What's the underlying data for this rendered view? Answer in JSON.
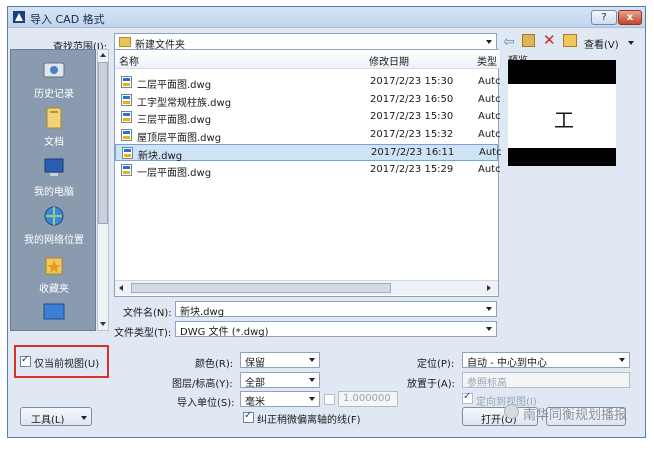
{
  "window": {
    "title": "导入 CAD 格式",
    "help_label": "?",
    "close_label": "x"
  },
  "toolbar": {
    "lookin_label": "查找范围(I):",
    "lookin_value": "新建文件夹",
    "view_label": "查看(V)"
  },
  "places": [
    {
      "label": "历史记录",
      "icon": "history-icon"
    },
    {
      "label": "文档",
      "icon": "documents-icon"
    },
    {
      "label": "我的电脑",
      "icon": "computer-icon"
    },
    {
      "label": "我的网络位置",
      "icon": "network-icon"
    },
    {
      "label": "收藏夹",
      "icon": "favorites-icon"
    }
  ],
  "columns": {
    "name": "名称",
    "modified": "修改日期",
    "type": "类型"
  },
  "files": [
    {
      "name": "二层平面图.dwg",
      "date": "2017/2/23 15:30",
      "type": "Autc"
    },
    {
      "name": "工字型常规柱族.dwg",
      "date": "2017/2/23 16:50",
      "type": "Autc"
    },
    {
      "name": "三层平面图.dwg",
      "date": "2017/2/23 15:30",
      "type": "Autc"
    },
    {
      "name": "屋顶层平面图.dwg",
      "date": "2017/2/23 15:32",
      "type": "Autc"
    },
    {
      "name": "新块.dwg",
      "date": "2017/2/23 16:11",
      "type": "Autc"
    },
    {
      "name": "一层平面图.dwg",
      "date": "2017/2/23 15:29",
      "type": "Autc"
    }
  ],
  "preview": {
    "label": "预览",
    "symbol": "工"
  },
  "filename": {
    "label": "文件名(N):",
    "value": "新块.dwg"
  },
  "filetype": {
    "label": "文件类型(T):",
    "value": "DWG 文件 (*.dwg)"
  },
  "current_view": {
    "label": "仅当前视图(U)",
    "checked": true
  },
  "options": {
    "color_label": "颜色(R):",
    "color_value": "保留",
    "layers_label": "图层/标高(Y):",
    "layers_value": "全部",
    "units_label": "导入单位(S):",
    "units_value": "毫米",
    "units_factor": "1.000000",
    "correct_label": "纠正稍微偏离轴的线(F)",
    "position_label": "定位(P):",
    "position_value": "自动 - 中心到中心",
    "place_label": "放置于(A):",
    "place_value": "参照标高",
    "orient_label": "定向到视图(I)"
  },
  "buttons": {
    "tools": "工具(L)",
    "open": "打开(O)"
  },
  "watermark": "南华同衡规划播报"
}
